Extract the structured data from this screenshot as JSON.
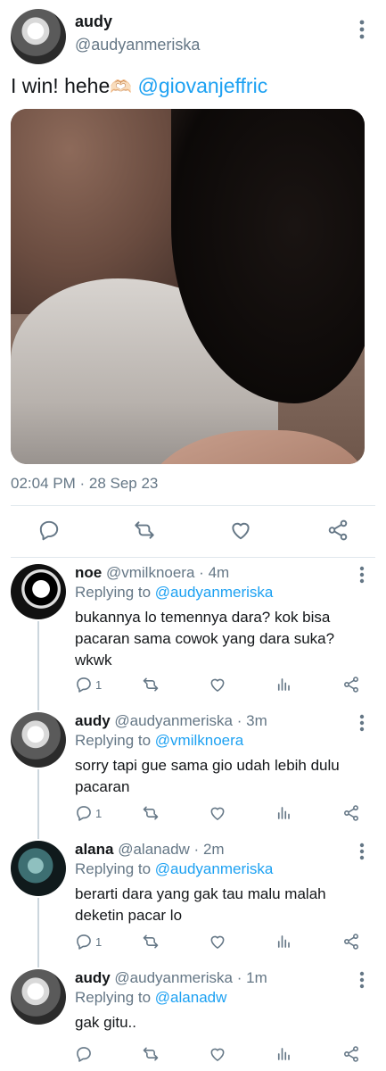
{
  "main_tweet": {
    "name": "audy",
    "handle": "@audyanmeriska",
    "text": "I win! hehe",
    "emoji": "🫶🏻",
    "mention": "@giovanjeffric",
    "timestamp": "02:04 PM · 28 Sep 23"
  },
  "replies": [
    {
      "name": "noe",
      "handle": "@vmilknoera",
      "time": "4m",
      "replying_prefix": "Replying to",
      "replying_to": "@audyanmeriska",
      "text": "bukannya lo temennya dara? kok bisa pacaran sama cowok yang dara suka? wkwk",
      "reply_count": "1"
    },
    {
      "name": "audy",
      "handle": "@audyanmeriska",
      "time": "3m",
      "replying_prefix": "Replying to",
      "replying_to": "@vmilknoera",
      "text": "sorry tapi gue sama gio udah lebih dulu pacaran",
      "reply_count": "1"
    },
    {
      "name": "alana",
      "handle": "@alanadw",
      "time": "2m",
      "replying_prefix": "Replying to",
      "replying_to": "@audyanmeriska",
      "text": "berarti dara yang gak tau malu malah deketin pacar lo",
      "reply_count": "1"
    },
    {
      "name": "audy",
      "handle": "@audyanmeriska",
      "time": "1m",
      "replying_prefix": "Replying to",
      "replying_to": "@alanadw",
      "text": "gak gitu..",
      "reply_count": ""
    }
  ],
  "icons": {
    "accent": "#1da1f2",
    "muted": "#657786",
    "reply": "reply-icon",
    "retweet": "retweet-icon",
    "like": "heart-icon",
    "analytics": "analytics-icon",
    "share": "share-icon",
    "more": "more-vertical-icon"
  }
}
